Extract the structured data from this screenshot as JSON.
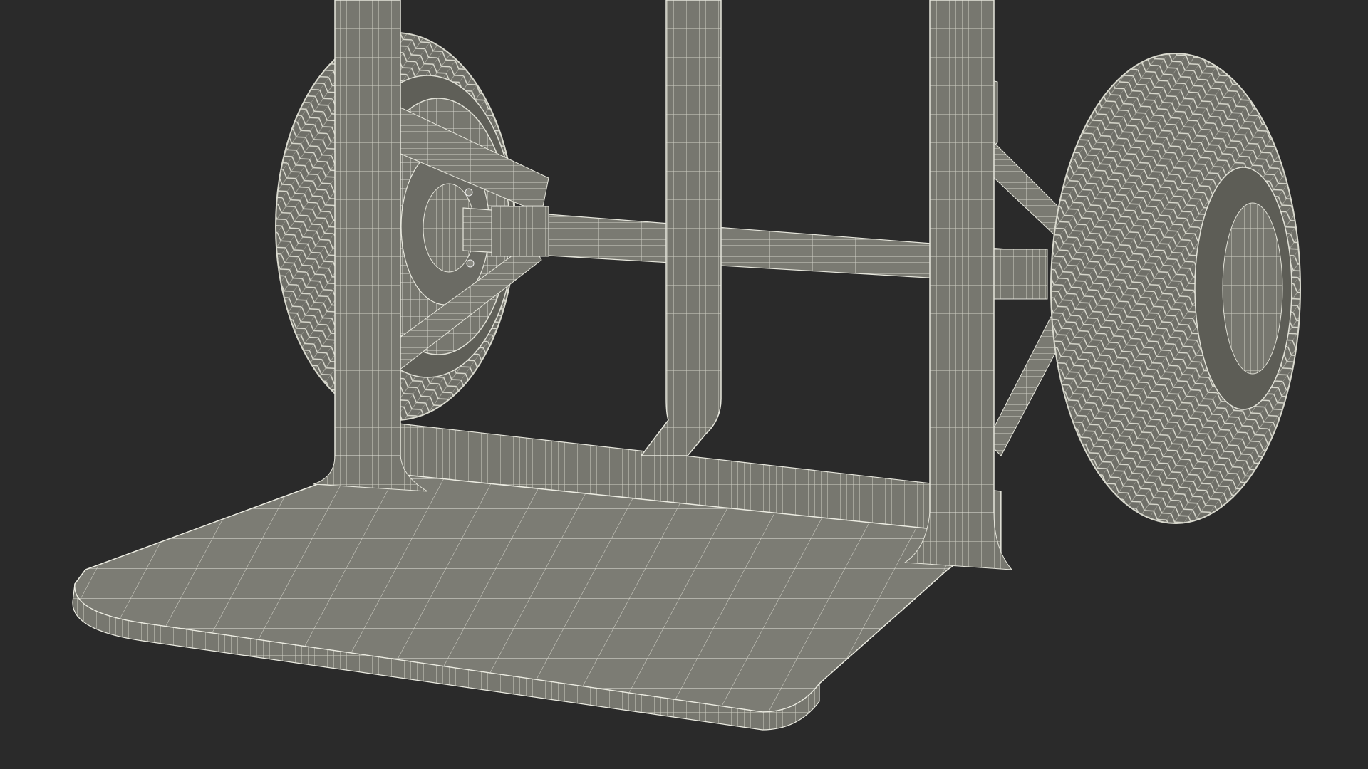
{
  "scene": {
    "subject": "hand-truck-wireframe",
    "colors": {
      "background": "#2a2a2a",
      "surface": "#77776f",
      "surface_light": "#85857c",
      "surface_dark": "#606059",
      "wire": "#e6e6dc",
      "wire_dim": "#c9c9bf",
      "tread": "#d2d2c7"
    }
  }
}
